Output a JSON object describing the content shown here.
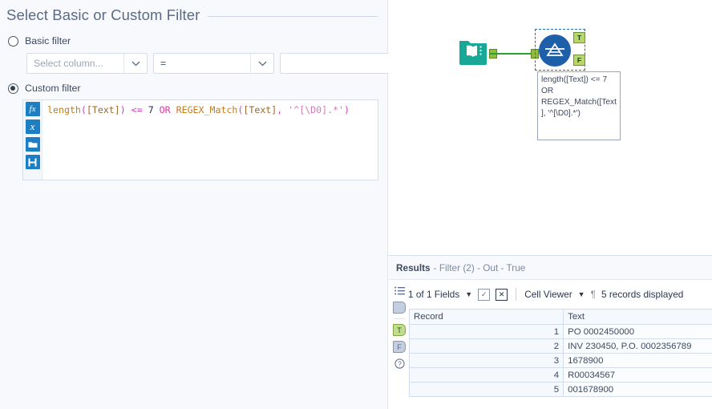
{
  "config": {
    "title": "Select Basic or Custom Filter",
    "basic_filter": {
      "label": "Basic filter",
      "selected": false
    },
    "custom_filter": {
      "label": "Custom filter",
      "selected": true
    },
    "column_select": {
      "placeholder": "Select column...",
      "value": ""
    },
    "operator_select": {
      "value": "="
    },
    "value_input": {
      "value": "",
      "placeholder": ""
    },
    "formula": {
      "full_text": "length([Text]) <= 7 OR REGEX_Match([Text], '^[\\D0].*')",
      "tokens": {
        "fn1": "length",
        "open1": "(",
        "field1": "[Text]",
        "close1": ")",
        "op1": "<=",
        "num1": "7",
        "kw1": "OR",
        "fn2": "REGEX_Match",
        "open2": "(",
        "field2": "[Text]",
        "comma": ",",
        "str1": "'^[\\D0].*'",
        "close2": ")"
      }
    },
    "formula_tools": [
      {
        "name": "insert-function-button",
        "glyph": "fx"
      },
      {
        "name": "insert-variable-button",
        "glyph": "x"
      },
      {
        "name": "open-formula-button",
        "glyph": "folder"
      },
      {
        "name": "save-formula-button",
        "glyph": "save"
      }
    ]
  },
  "canvas": {
    "input_tool": {
      "name": "input-data-tool",
      "color": "#17a898"
    },
    "filter_tool": {
      "name": "filter-tool",
      "color": "#1d5fa8",
      "selected": true
    },
    "anchor_true": "T",
    "anchor_false": "F",
    "connection_color": "#2ca02c",
    "annotation": "length([Text]) <= 7 OR REGEX_Match([Text], '^[\\D0].*')"
  },
  "results": {
    "header_label": "Results",
    "header_path": "- Filter (2) - Out - True",
    "toolbar": {
      "fields_label": "1 of 1 Fields",
      "select_all_label": "✓",
      "deselect_all_label": "✕",
      "view_mode": "Cell Viewer",
      "record_count": "5 records displayed"
    },
    "sidebar_icons": [
      {
        "name": "metadata-list-icon",
        "label": ""
      },
      {
        "name": "data-pane-icon",
        "label": ""
      },
      {
        "name": "true-output-icon",
        "label": "T",
        "active": true
      },
      {
        "name": "false-output-icon",
        "label": "F",
        "active": false
      },
      {
        "name": "help-icon",
        "label": "?"
      }
    ],
    "table": {
      "columns": [
        "Record",
        "Text"
      ],
      "rows": [
        {
          "record": "1",
          "text": "PO 0002450000"
        },
        {
          "record": "2",
          "text": "INV 230450, P.O. 0002356789"
        },
        {
          "record": "3",
          "text": "1678900"
        },
        {
          "record": "4",
          "text": "R00034567"
        },
        {
          "record": "5",
          "text": "001678900"
        }
      ]
    }
  }
}
